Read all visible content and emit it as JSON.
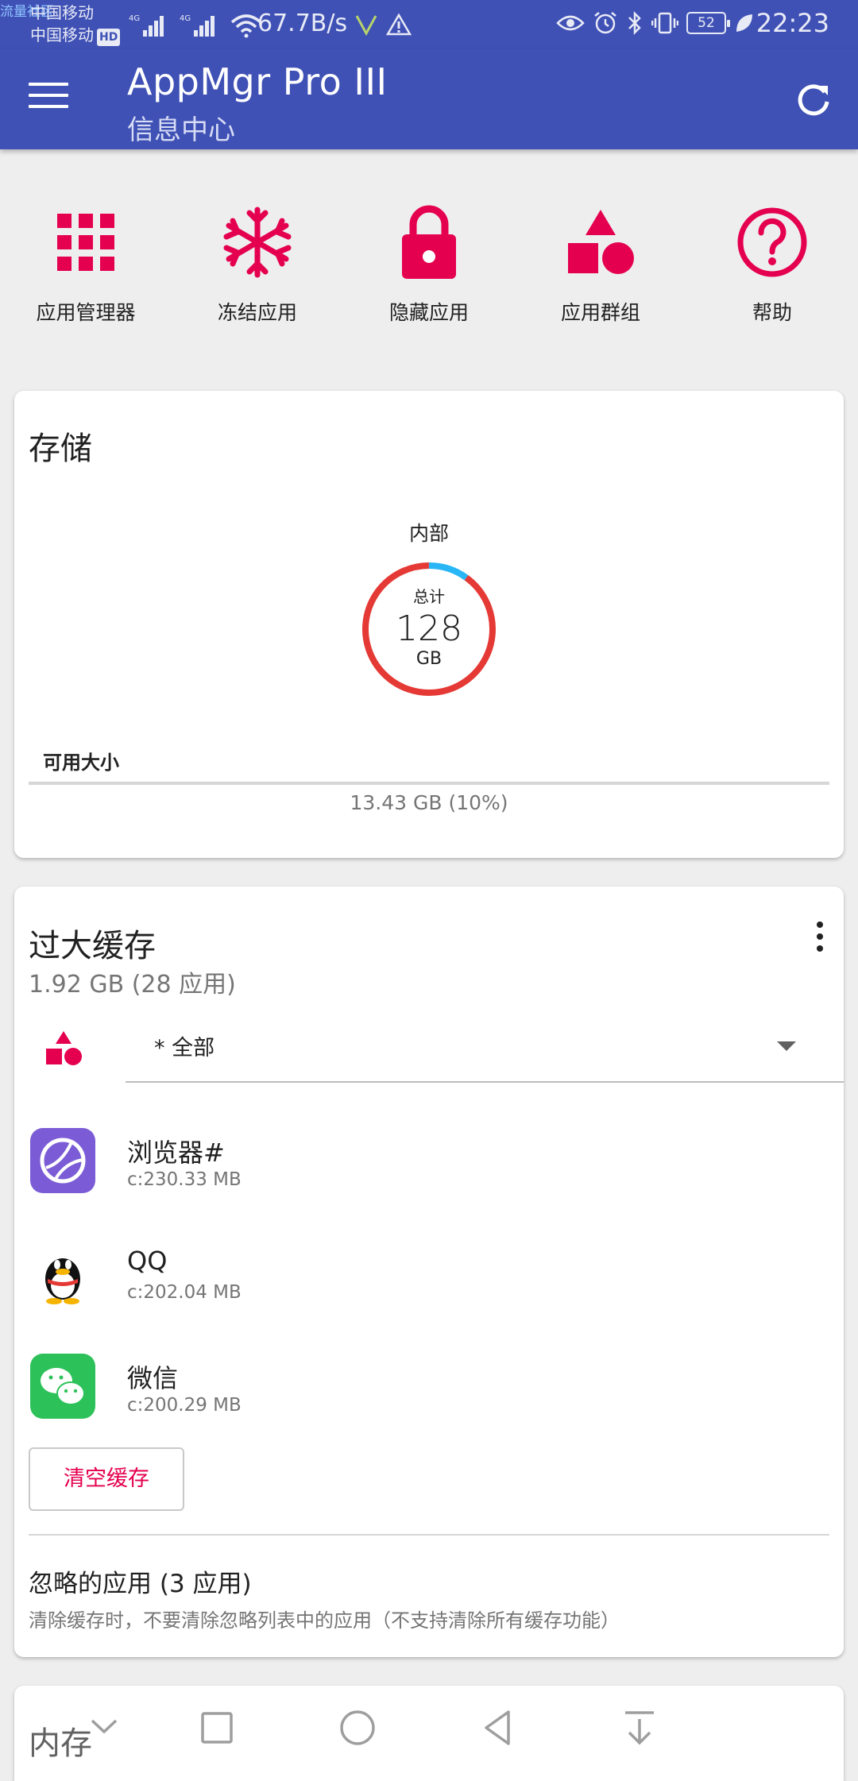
{
  "status_bar": {
    "watermark": "流量社区",
    "carrier1": "中国移动",
    "carrier2": "中国移动",
    "hd": "HD",
    "net_speed": "67.7B/s",
    "battery": "52",
    "time": "22:23"
  },
  "appbar": {
    "title": "AppMgr Pro III",
    "subtitle": "信息中心"
  },
  "shortcuts": [
    {
      "label": "应用管理器",
      "icon": "grid-icon"
    },
    {
      "label": "冻结应用",
      "icon": "snowflake-icon"
    },
    {
      "label": "隐藏应用",
      "icon": "lock-icon"
    },
    {
      "label": "应用群组",
      "icon": "shapes-icon"
    },
    {
      "label": "帮助",
      "icon": "help-icon"
    }
  ],
  "colors": {
    "primary": "#3f51b5",
    "accent": "#e5004f",
    "used": "#e53935",
    "free": "#29b6f6"
  },
  "storage": {
    "title": "存储",
    "location": "内部",
    "total_label": "总计",
    "total_value": "128",
    "total_unit": "GB",
    "free_fraction": 0.1,
    "available_label": "可用大小",
    "available_value": "13.43 GB (10%)"
  },
  "cache": {
    "title": "过大缓存",
    "summary": "1.92 GB (28 应用)",
    "filter_value": "* 全部",
    "apps": [
      {
        "name": "浏览器#",
        "size": "c:230.33 MB",
        "icon": "browser-icon"
      },
      {
        "name": "QQ",
        "size": "c:202.04 MB",
        "icon": "qq-icon"
      },
      {
        "name": "微信",
        "size": "c:200.29 MB",
        "icon": "wechat-icon"
      }
    ],
    "clear_button": "清空缓存",
    "ignored_title": "忽略的应用 (3 应用)",
    "ignored_desc": "清除缓存时，不要清除忽略列表中的应用（不支持清除所有缓存功能）"
  },
  "memory": {
    "title": "内存"
  }
}
